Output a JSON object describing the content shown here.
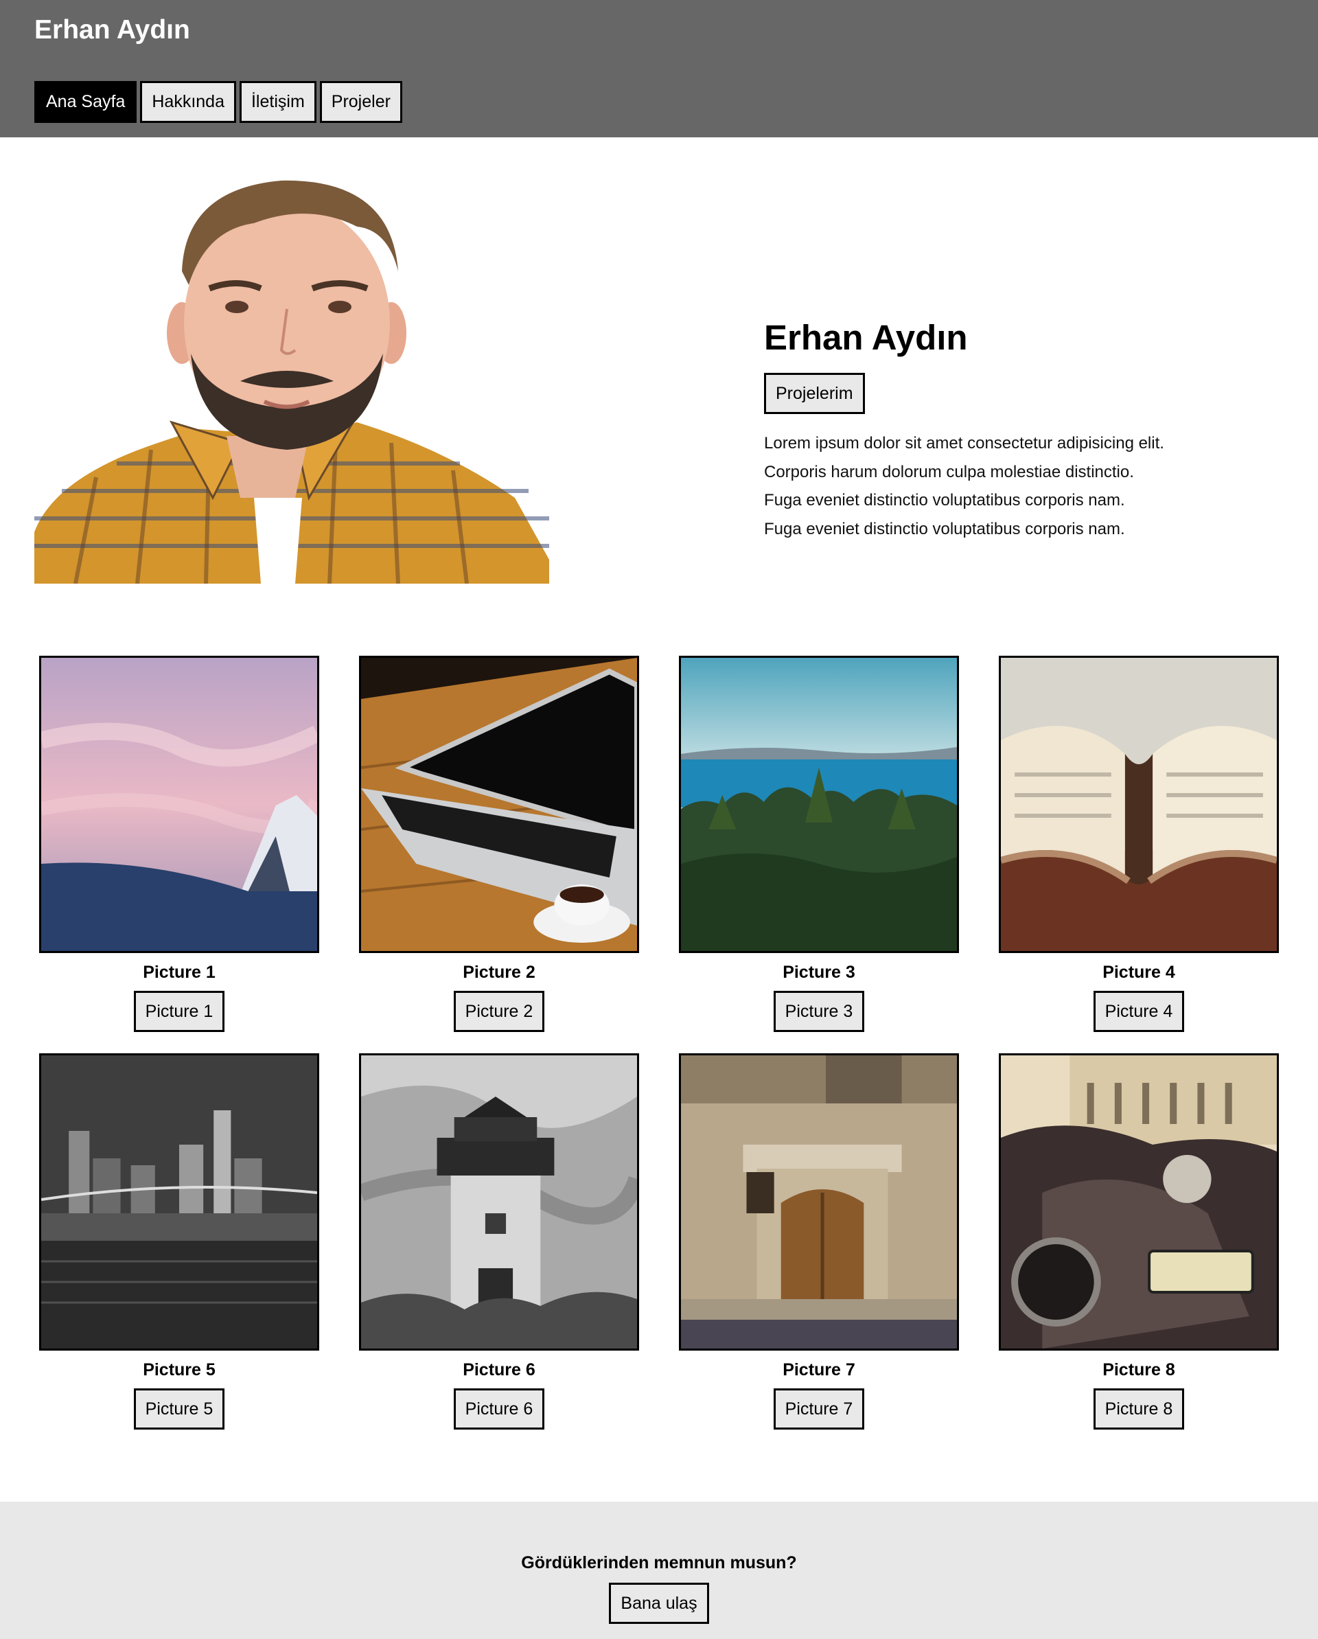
{
  "header": {
    "title": "Erhan Aydın",
    "nav": [
      "Ana Sayfa",
      "Hakkında",
      "İletişim",
      "Projeler"
    ]
  },
  "hero": {
    "name": "Erhan Aydın",
    "button": "Projelerim",
    "lines": [
      "Lorem ipsum dolor sit amet consectetur adipisicing elit.",
      "Corporis harum dolorum culpa molestiae distinctio.",
      "Fuga eveniet distinctio voluptatibus corporis nam.",
      "Fuga eveniet distinctio voluptatibus corporis nam."
    ]
  },
  "gallery": [
    {
      "title": "Picture 1",
      "button": "Picture 1"
    },
    {
      "title": "Picture 2",
      "button": "Picture 2"
    },
    {
      "title": "Picture 3",
      "button": "Picture 3"
    },
    {
      "title": "Picture 4",
      "button": "Picture 4"
    },
    {
      "title": "Picture 5",
      "button": "Picture 5"
    },
    {
      "title": "Picture 6",
      "button": "Picture 6"
    },
    {
      "title": "Picture 7",
      "button": "Picture 7"
    },
    {
      "title": "Picture 8",
      "button": "Picture 8"
    }
  ],
  "footer": {
    "question": "Gördüklerinden memnun musun?",
    "button": "Bana ulaş"
  }
}
